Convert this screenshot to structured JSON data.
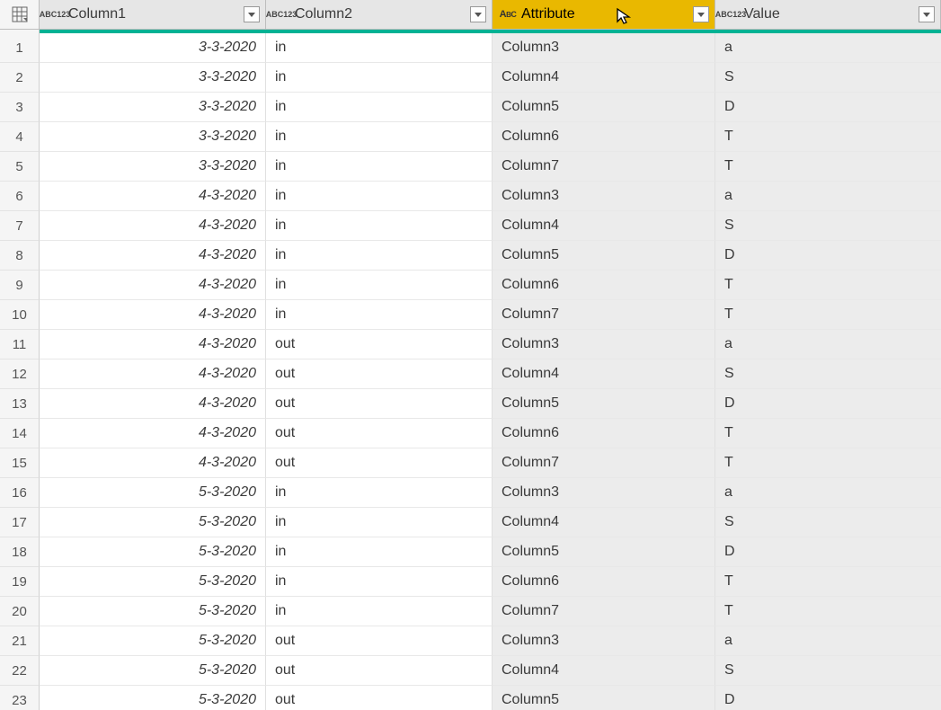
{
  "columns": [
    {
      "name": "Column1",
      "typeIcon": "abc123",
      "selected": false
    },
    {
      "name": "Column2",
      "typeIcon": "abc123",
      "selected": false
    },
    {
      "name": "Attribute",
      "typeIcon": "abc-text",
      "selected": true
    },
    {
      "name": "Value",
      "typeIcon": "abc123",
      "selected": false
    }
  ],
  "rows": [
    {
      "n": "1",
      "c1": "3-3-2020",
      "c2": "in",
      "c3": "Column3",
      "c4": "a"
    },
    {
      "n": "2",
      "c1": "3-3-2020",
      "c2": "in",
      "c3": "Column4",
      "c4": "S"
    },
    {
      "n": "3",
      "c1": "3-3-2020",
      "c2": "in",
      "c3": "Column5",
      "c4": "D"
    },
    {
      "n": "4",
      "c1": "3-3-2020",
      "c2": "in",
      "c3": "Column6",
      "c4": "T"
    },
    {
      "n": "5",
      "c1": "3-3-2020",
      "c2": "in",
      "c3": "Column7",
      "c4": "T"
    },
    {
      "n": "6",
      "c1": "4-3-2020",
      "c2": "in",
      "c3": "Column3",
      "c4": "a"
    },
    {
      "n": "7",
      "c1": "4-3-2020",
      "c2": "in",
      "c3": "Column4",
      "c4": "S"
    },
    {
      "n": "8",
      "c1": "4-3-2020",
      "c2": "in",
      "c3": "Column5",
      "c4": "D"
    },
    {
      "n": "9",
      "c1": "4-3-2020",
      "c2": "in",
      "c3": "Column6",
      "c4": "T"
    },
    {
      "n": "10",
      "c1": "4-3-2020",
      "c2": "in",
      "c3": "Column7",
      "c4": "T"
    },
    {
      "n": "11",
      "c1": "4-3-2020",
      "c2": "out",
      "c3": "Column3",
      "c4": "a"
    },
    {
      "n": "12",
      "c1": "4-3-2020",
      "c2": "out",
      "c3": "Column4",
      "c4": "S"
    },
    {
      "n": "13",
      "c1": "4-3-2020",
      "c2": "out",
      "c3": "Column5",
      "c4": "D"
    },
    {
      "n": "14",
      "c1": "4-3-2020",
      "c2": "out",
      "c3": "Column6",
      "c4": "T"
    },
    {
      "n": "15",
      "c1": "4-3-2020",
      "c2": "out",
      "c3": "Column7",
      "c4": "T"
    },
    {
      "n": "16",
      "c1": "5-3-2020",
      "c2": "in",
      "c3": "Column3",
      "c4": "a"
    },
    {
      "n": "17",
      "c1": "5-3-2020",
      "c2": "in",
      "c3": "Column4",
      "c4": "S"
    },
    {
      "n": "18",
      "c1": "5-3-2020",
      "c2": "in",
      "c3": "Column5",
      "c4": "D"
    },
    {
      "n": "19",
      "c1": "5-3-2020",
      "c2": "in",
      "c3": "Column6",
      "c4": "T"
    },
    {
      "n": "20",
      "c1": "5-3-2020",
      "c2": "in",
      "c3": "Column7",
      "c4": "T"
    },
    {
      "n": "21",
      "c1": "5-3-2020",
      "c2": "out",
      "c3": "Column3",
      "c4": "a"
    },
    {
      "n": "22",
      "c1": "5-3-2020",
      "c2": "out",
      "c3": "Column4",
      "c4": "S"
    },
    {
      "n": "23",
      "c1": "5-3-2020",
      "c2": "out",
      "c3": "Column5",
      "c4": "D"
    }
  ]
}
